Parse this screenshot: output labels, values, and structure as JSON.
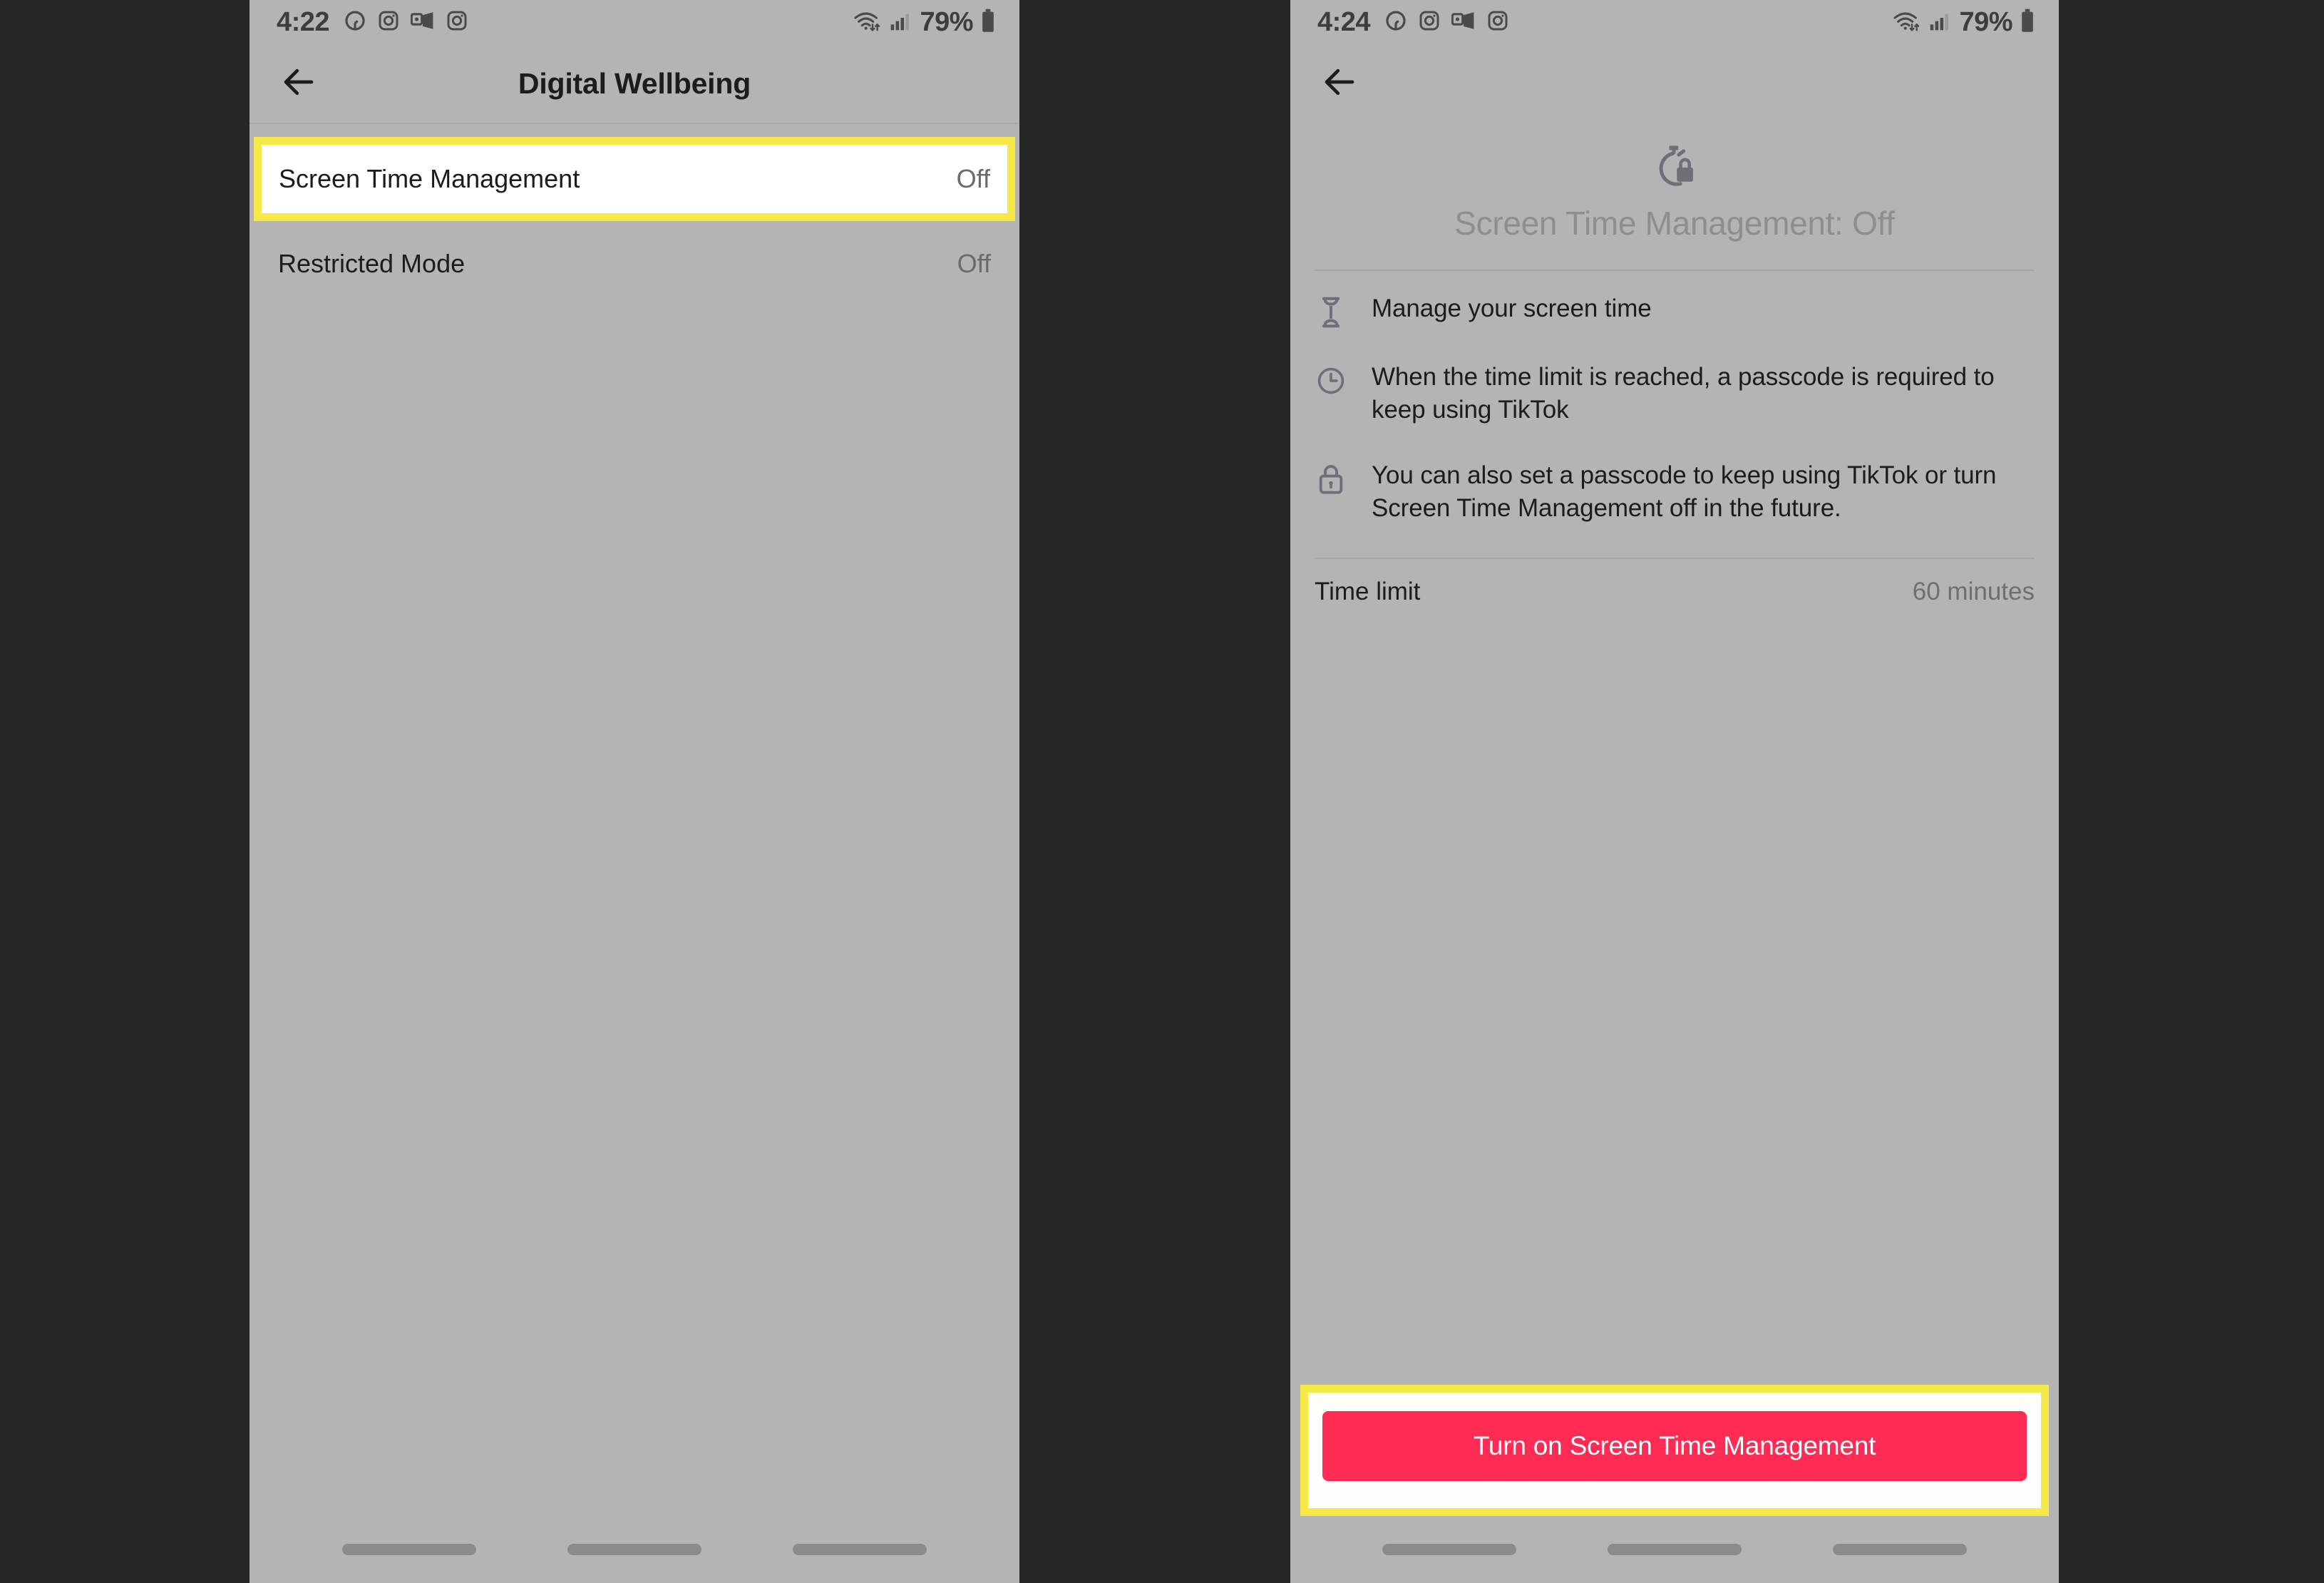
{
  "colors": {
    "phone_bg": "#b4b4b4",
    "backdrop": "#262626",
    "highlight_yellow": "#f7ea48",
    "cta_pink": "#fe2c55",
    "primary_text": "#1c1c1c",
    "muted_text": "#6b6b6b"
  },
  "left_screen": {
    "status_bar": {
      "time": "4:22",
      "battery_percent": "79%",
      "icons": [
        "alexa-icon",
        "instagram-icon",
        "outlook-icon",
        "instagram-icon"
      ],
      "right_icons": [
        "wifi-icon",
        "cellular-signal-icon",
        "battery-icon"
      ]
    },
    "app_bar": {
      "back_icon": "arrow-left-icon",
      "title": "Digital Wellbeing"
    },
    "rows": [
      {
        "label": "Screen Time Management",
        "value": "Off",
        "highlighted": true
      },
      {
        "label": "Restricted Mode",
        "value": "Off",
        "highlighted": false
      }
    ],
    "nav_bar": {
      "pills": 3
    }
  },
  "right_screen": {
    "status_bar": {
      "time": "4:24",
      "battery_percent": "79%",
      "icons": [
        "alexa-icon",
        "instagram-icon",
        "outlook-icon",
        "instagram-icon"
      ],
      "right_icons": [
        "wifi-icon",
        "cellular-signal-icon",
        "battery-icon"
      ]
    },
    "app_bar": {
      "back_icon": "arrow-left-icon",
      "title": ""
    },
    "hero": {
      "icon": "stopwatch-lock-icon",
      "title": "Screen Time Management: Off"
    },
    "features": [
      {
        "icon": "hourglass-icon",
        "text": "Manage your screen time"
      },
      {
        "icon": "clock-icon",
        "text": "When the time limit is reached, a passcode is required to keep using TikTok"
      },
      {
        "icon": "lock-icon",
        "text": "You can also set a passcode to keep using TikTok or turn Screen Time Management off in the future."
      }
    ],
    "time_limit": {
      "label": "Time limit",
      "value": "60 minutes"
    },
    "cta": {
      "label": "Turn on Screen Time Management",
      "highlighted": true
    },
    "nav_bar": {
      "pills": 3
    }
  }
}
